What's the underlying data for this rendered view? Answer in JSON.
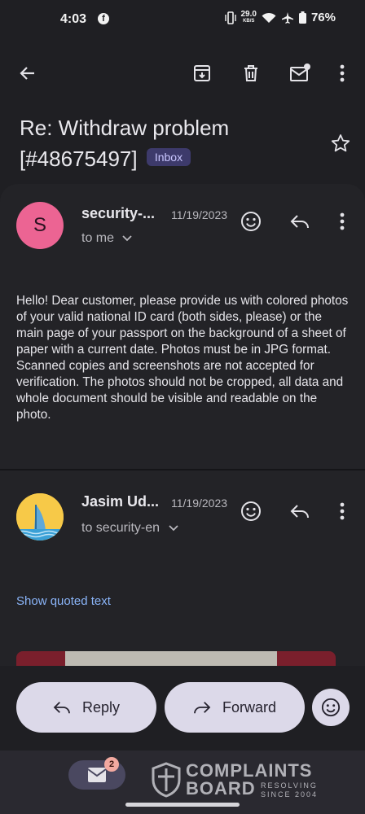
{
  "status_bar": {
    "time": "4:03",
    "app_icon": "facebook-icon",
    "data_speed": "29.0",
    "data_unit": "KB/S",
    "battery": "76%"
  },
  "toolbar": {
    "icons": [
      "back-arrow-icon",
      "archive-icon",
      "delete-icon",
      "mark-unread-icon",
      "more-vert-icon"
    ]
  },
  "email": {
    "subject_line1": "Re: Withdraw problem",
    "subject_line2": "[#48675497]",
    "label": "Inbox"
  },
  "messages": [
    {
      "avatar_letter": "S",
      "sender": "security-...",
      "date": "11/19/2023",
      "recipient": "to me",
      "body": "Hello! Dear customer, please provide us with colored photos of your valid national ID card (both sides, please) or the main page of your passport on the background of a sheet of paper with a current date. Photos must be in JPG format.\nScanned copies and screenshots are not accepted for verification. The photos should not be cropped, all data and whole document should be visible and readable on the photo."
    },
    {
      "sender": "Jasim Ud...",
      "date": "11/19/2023",
      "recipient": "to security-en",
      "show_quoted": "Show quoted text"
    }
  ],
  "actions": {
    "reply": "Reply",
    "forward": "Forward"
  },
  "nav": {
    "mail_badge": "2"
  },
  "watermark": {
    "line1": "COMPLAINTS",
    "line2": "BOARD",
    "sub1": "RESOLVING",
    "sub2": "SINCE 2004"
  },
  "colors": {
    "background": "#1f1f23",
    "avatar_s": "#ec6493",
    "link": "#8ab4f8",
    "pill": "#dcd9e9",
    "inbox_badge": "#3d3a6b"
  }
}
